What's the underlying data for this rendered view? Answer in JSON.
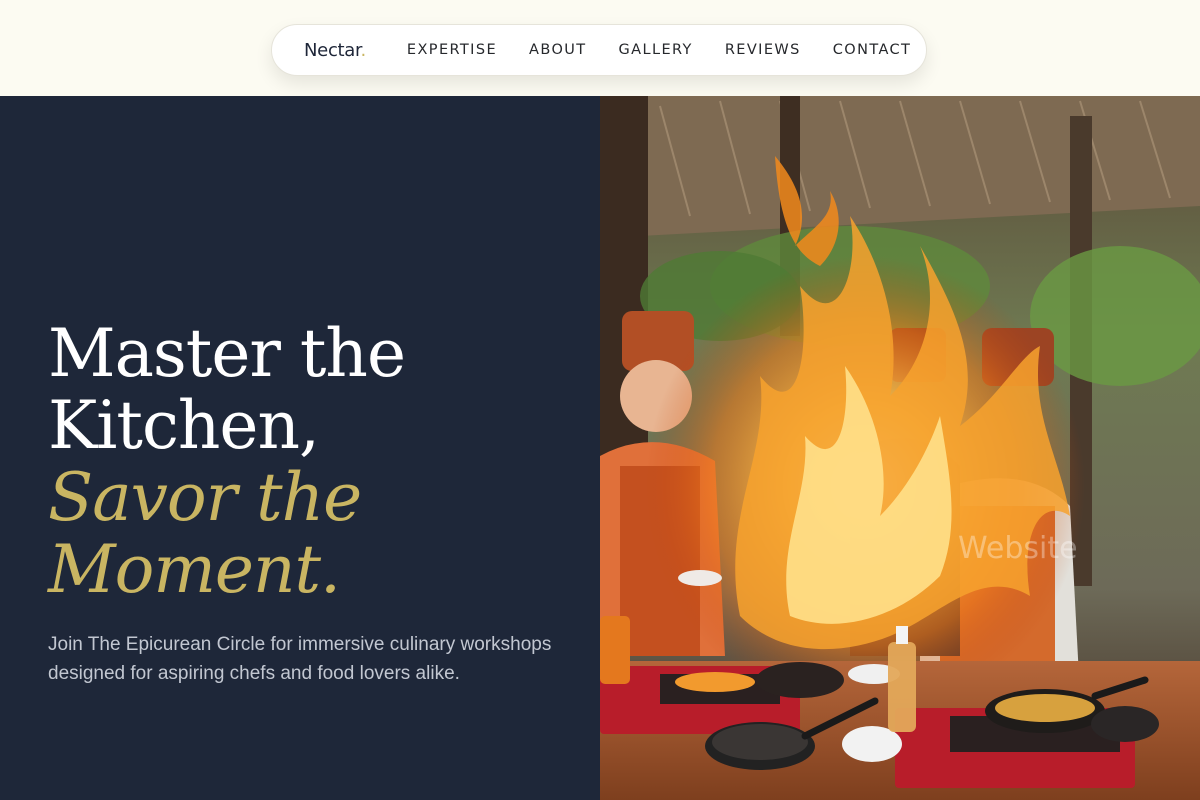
{
  "brand": {
    "name": "Nectar",
    "dot": "."
  },
  "nav": {
    "links": [
      "EXPERTISE",
      "ABOUT",
      "GALLERY",
      "REVIEWS",
      "CONTACT"
    ]
  },
  "hero": {
    "headline_line1": "Master the",
    "headline_line2": "Kitchen,",
    "headline_line3": "Savor the",
    "headline_line4": "Moment.",
    "subtext": "Join The Epicurean Circle for immersive culinary workshops designed for aspiring chefs and food lovers alike.",
    "image_watermark": "Website"
  },
  "colors": {
    "accent_gold": "#c9b562",
    "panel_navy": "#1e2739",
    "page_cream": "#fcfbf2"
  }
}
